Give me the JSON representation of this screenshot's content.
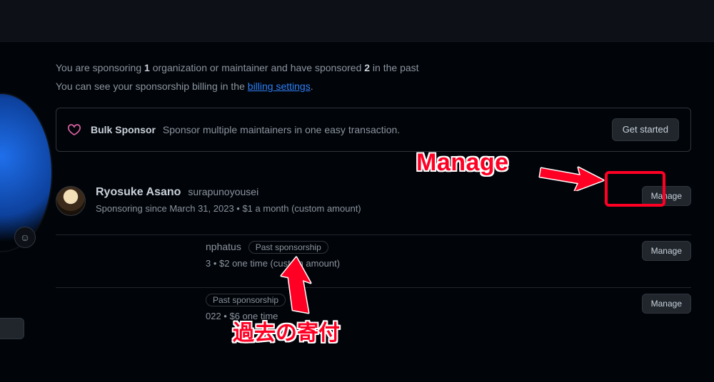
{
  "intro": {
    "prefix": "You are sponsoring ",
    "count_current": "1",
    "mid": " organization or maintainer and have sponsored ",
    "count_past": "2",
    "suffix": " in the past"
  },
  "billing": {
    "prefix": "You can see your sponsorship billing in the ",
    "link": "billing settings",
    "suffix": "."
  },
  "bulk": {
    "title": "Bulk Sponsor",
    "desc": "Sponsor multiple maintainers in one easy transaction.",
    "cta": "Get started"
  },
  "rows": [
    {
      "name": "Ryosuke Asano",
      "handle": "surapunoyousei",
      "meta": "Sponsoring since March 31, 2023 • $1 a month (custom amount)",
      "manage": "Manage"
    },
    {
      "name_fragment": "nphatus",
      "pill": "Past sponsorship",
      "meta": "3 • $2 one time (custom amount)",
      "manage": "Manage"
    },
    {
      "pill": "Past sponsorship",
      "meta": "022 • $6 one time",
      "manage": "Manage"
    }
  ],
  "annotations": {
    "manage_label": "Manage",
    "past_label": "過去の寄付"
  }
}
